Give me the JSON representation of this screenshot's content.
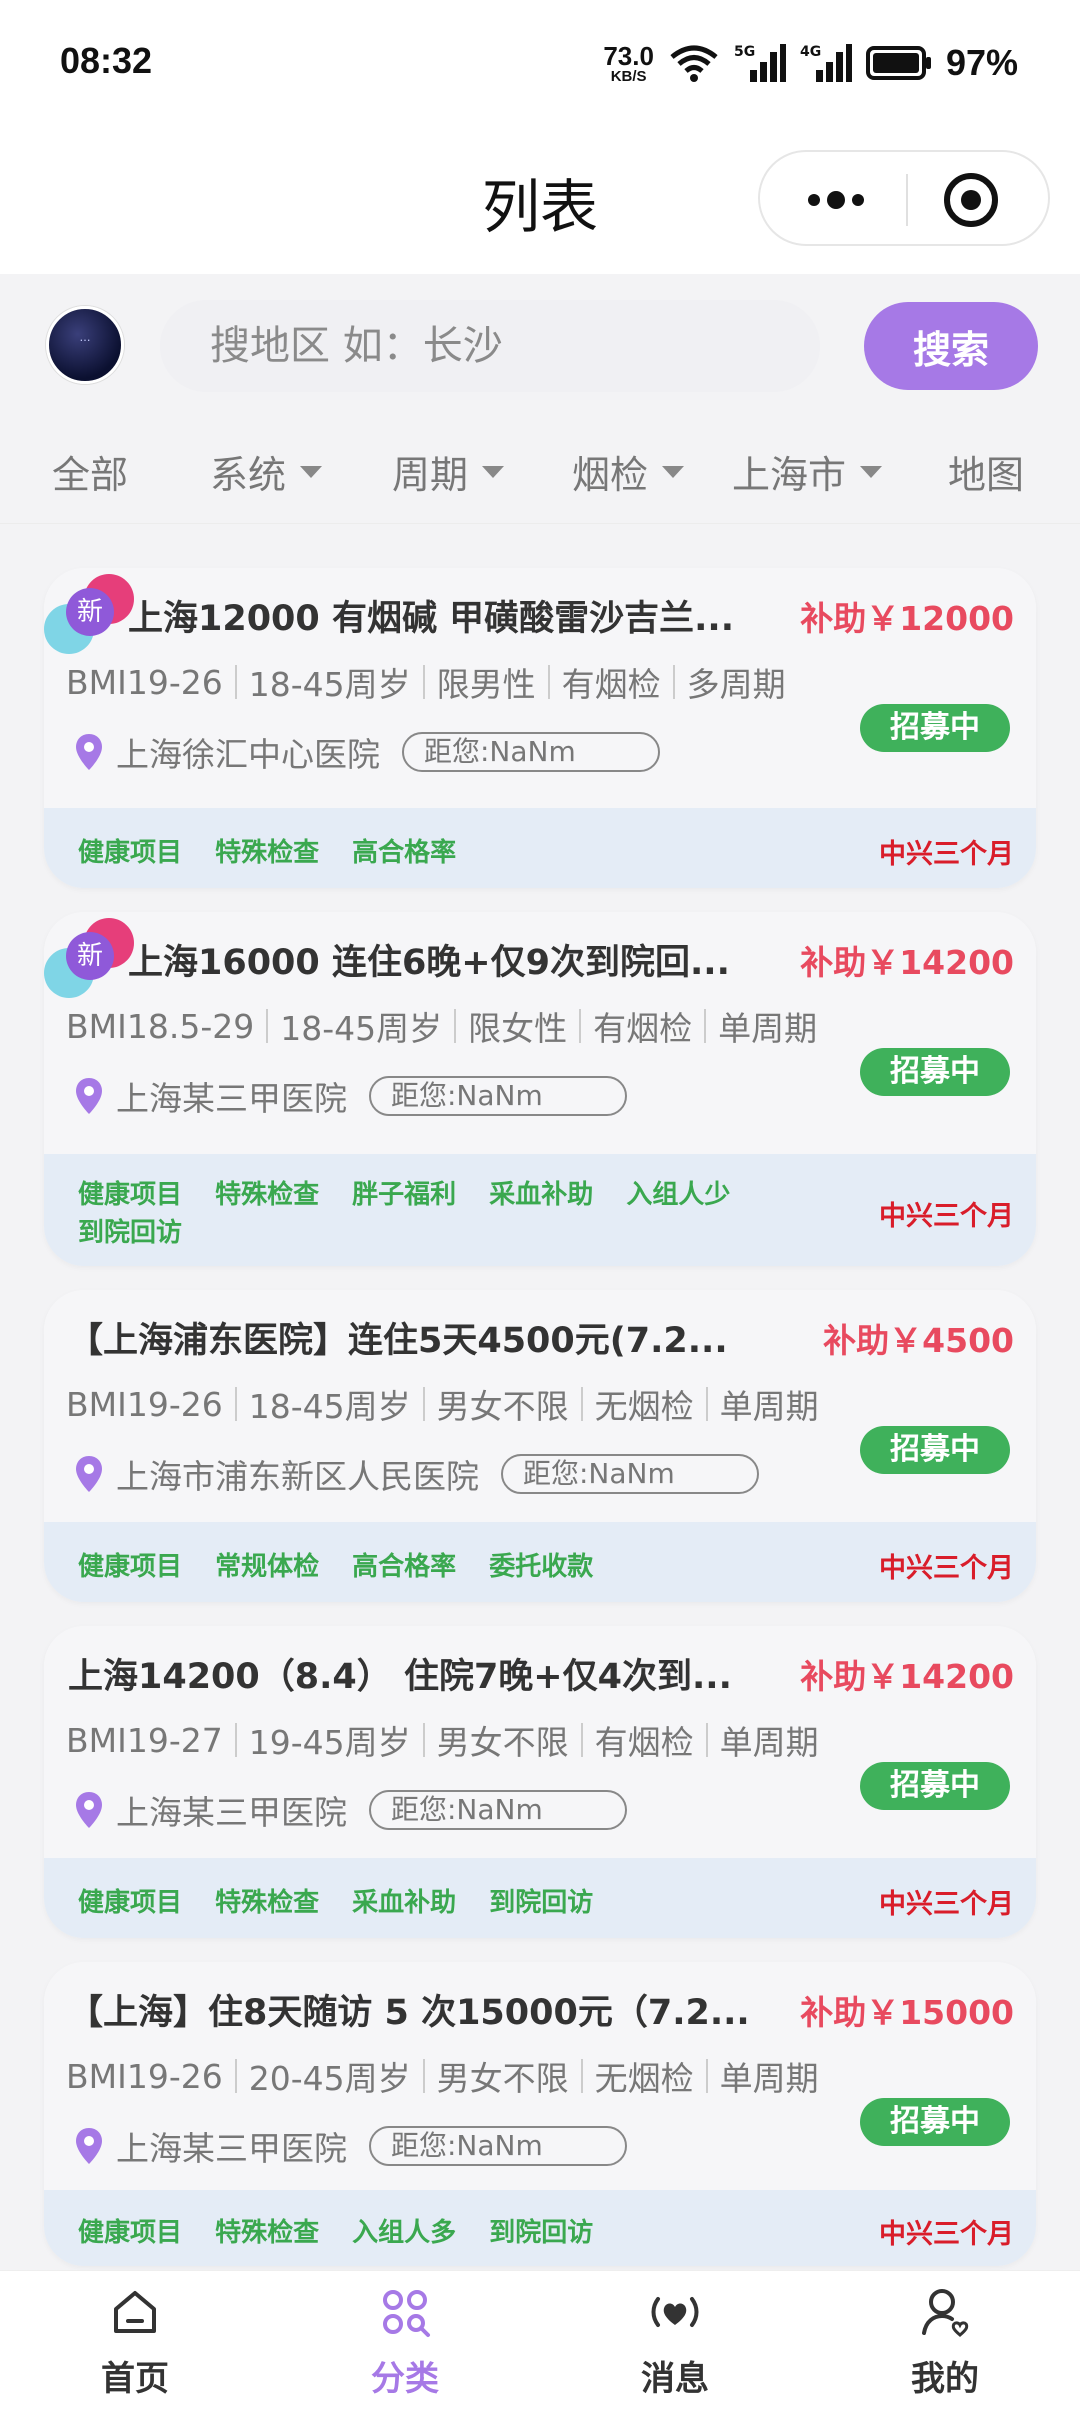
{
  "status_bar": {
    "time": "08:32",
    "net_speed": "73.0",
    "net_unit": "KB/S",
    "signal_5g": "5G",
    "signal_4g": "4G",
    "battery": "97%"
  },
  "header": {
    "title": "列表"
  },
  "search": {
    "logo_text": "…",
    "placeholder": "搜地区 如：长沙",
    "button": "搜索"
  },
  "filters": [
    {
      "label": "全部",
      "dropdown": false
    },
    {
      "label": "系统",
      "dropdown": true
    },
    {
      "label": "周期",
      "dropdown": true
    },
    {
      "label": "烟检",
      "dropdown": true
    },
    {
      "label": "上海市",
      "dropdown": true
    },
    {
      "label": "地图",
      "dropdown": false
    }
  ],
  "cards": [
    {
      "is_new": true,
      "new_label": "新",
      "title": "上海12000 有烟碱 甲磺酸雷沙吉兰...",
      "subsidy": "补助￥12000",
      "attrs": [
        "BMI19-26",
        "18-45周岁",
        "限男性",
        "有烟检",
        "多周期"
      ],
      "status": "招募中",
      "hospital": "上海徐汇中心医院",
      "distance": "距您:NaNm",
      "tags": [
        "健康项目",
        "特殊检查",
        "高合格率"
      ],
      "tags2": [],
      "duration": "中兴三个月"
    },
    {
      "is_new": true,
      "new_label": "新",
      "title": "上海16000 连住6晚+仅9次到院回...",
      "subsidy": "补助￥14200",
      "attrs": [
        "BMI18.5-29",
        "18-45周岁",
        "限女性",
        "有烟检",
        "单周期"
      ],
      "status": "招募中",
      "hospital": "上海某三甲医院",
      "distance": "距您:NaNm",
      "tags": [
        "健康项目",
        "特殊检查",
        "胖子福利",
        "采血补助",
        "入组人少"
      ],
      "tags2": [
        "到院回访"
      ],
      "duration": "中兴三个月"
    },
    {
      "is_new": false,
      "new_label": "",
      "title": "【上海浦东医院】连住5天4500元(7.2...",
      "subsidy": "补助￥4500",
      "attrs": [
        "BMI19-26",
        "18-45周岁",
        "男女不限",
        "无烟检",
        "单周期"
      ],
      "status": "招募中",
      "hospital": "上海市浦东新区人民医院",
      "distance": "距您:NaNm",
      "tags": [
        "健康项目",
        "常规体检",
        "高合格率",
        "委托收款"
      ],
      "tags2": [],
      "duration": "中兴三个月"
    },
    {
      "is_new": false,
      "new_label": "",
      "title": "上海14200（8.4） 住院7晚+仅4次到...",
      "subsidy": "补助￥14200",
      "attrs": [
        "BMI19-27",
        "19-45周岁",
        "男女不限",
        "有烟检",
        "单周期"
      ],
      "status": "招募中",
      "hospital": "上海某三甲医院",
      "distance": "距您:NaNm",
      "tags": [
        "健康项目",
        "特殊检查",
        "采血补助",
        "到院回访"
      ],
      "tags2": [],
      "duration": "中兴三个月"
    },
    {
      "is_new": false,
      "new_label": "",
      "title": "【上海】住8天随访 5 次15000元（7.2...",
      "subsidy": "补助￥15000",
      "attrs": [
        "BMI19-26",
        "20-45周岁",
        "男女不限",
        "无烟检",
        "单周期"
      ],
      "status": "招募中",
      "hospital": "上海某三甲医院",
      "distance": "距您:NaNm",
      "tags": [
        "健康项目",
        "特殊检查",
        "入组人多",
        "到院回访"
      ],
      "tags2": [],
      "duration": "中兴三个月"
    }
  ],
  "tabbar": [
    {
      "label": "首页",
      "icon": "home-icon",
      "active": false
    },
    {
      "label": "分类",
      "icon": "category-icon",
      "active": true
    },
    {
      "label": "消息",
      "icon": "message-heart-icon",
      "active": false
    },
    {
      "label": "我的",
      "icon": "profile-icon",
      "active": false
    }
  ],
  "colors": {
    "accent": "#a679e6",
    "subsidy": "#e84a5f",
    "status_green": "#3fb15b",
    "tag_green": "#3aa84f",
    "duration_red": "#d91d2a"
  }
}
